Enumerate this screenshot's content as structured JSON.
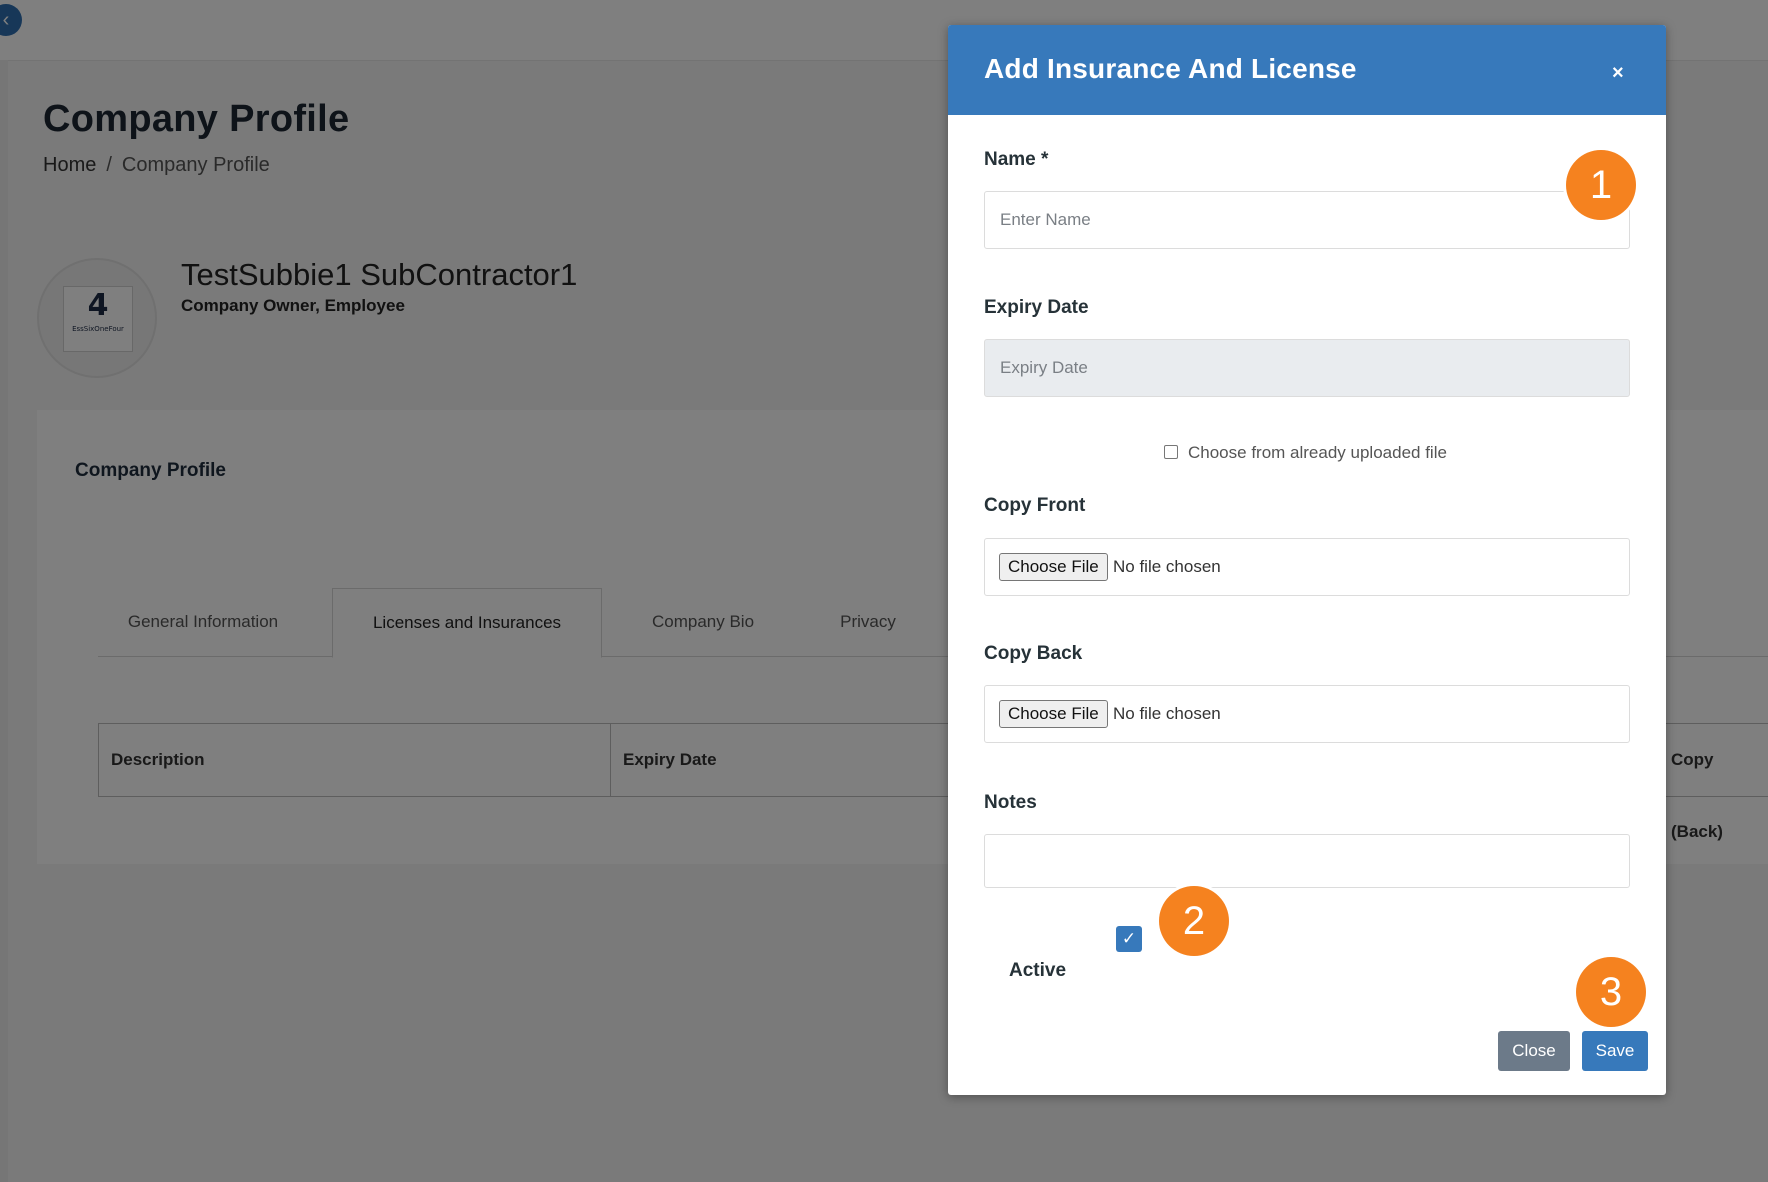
{
  "page": {
    "title": "Company Profile",
    "breadcrumb": {
      "home": "Home",
      "separator": "/",
      "current": "Company Profile"
    },
    "profile": {
      "name": "TestSubbie1 SubContractor1",
      "role": "Company Owner, Employee",
      "logo_number": "4",
      "logo_text": "EssSixOneFour"
    },
    "card_title": "Company Profile",
    "tabs": [
      {
        "label": "General Information",
        "active": false
      },
      {
        "label": "Licenses and Insurances",
        "active": true
      },
      {
        "label": "Company Bio",
        "active": false
      },
      {
        "label": "Privacy",
        "active": false
      }
    ],
    "table_headers": {
      "description": "Description",
      "expiry": "Expiry Date",
      "copy_back": "Copy (Back)"
    }
  },
  "modal": {
    "title": "Add Insurance And License",
    "close_icon": "×",
    "name_label": "Name *",
    "name_placeholder": "Enter Name",
    "expiry_label": "Expiry Date",
    "expiry_placeholder": "Expiry Date",
    "choose_uploaded": "Choose from already uploaded file",
    "copy_front_label": "Copy Front",
    "copy_back_label": "Copy Back",
    "choose_file": "Choose File",
    "no_file": "No file chosen",
    "notes_label": "Notes",
    "active_label": "Active",
    "active_checked": true,
    "close_button": "Close",
    "save_button": "Save"
  },
  "callouts": [
    "1",
    "2",
    "3"
  ],
  "colors": {
    "primary": "#3779bb",
    "callout": "#f5821f",
    "secondary_button": "#6c7a89"
  },
  "icons": {
    "back": "chevron-left-icon",
    "check": "check-icon",
    "close": "close-icon"
  }
}
